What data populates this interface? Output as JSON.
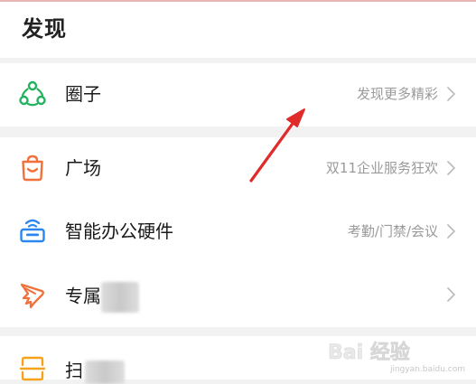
{
  "page": {
    "title": "发现"
  },
  "items": [
    {
      "label": "圈子",
      "hint": "发现更多精彩",
      "icon": "circle-network-icon",
      "color": "#21b25e"
    },
    {
      "label": "广场",
      "hint": "双11企业服务狂欢",
      "icon": "shopping-bag-icon",
      "color": "#f2713a"
    },
    {
      "label": "智能办公硬件",
      "hint": "考勤/门禁/会议",
      "icon": "office-device-icon",
      "color": "#2a86f0"
    },
    {
      "label": "专属",
      "hint": "",
      "icon": "wing-icon",
      "color": "#f2713a"
    },
    {
      "label": "扫",
      "hint": "",
      "icon": "scan-icon",
      "color": "#f5a31a"
    }
  ],
  "watermark": {
    "logo_text": "Bai 经验",
    "url_text": "jingyan.baidu.com"
  },
  "colors": {
    "annotation_arrow": "#e02b2b",
    "chevron": "#bdbdbd"
  }
}
